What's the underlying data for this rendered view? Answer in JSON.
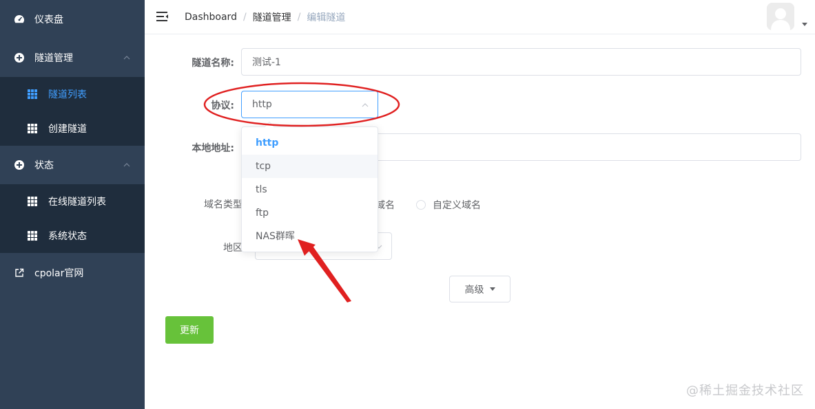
{
  "sidebar": {
    "items": [
      {
        "label": "仪表盘",
        "icon": "dashboard-icon"
      },
      {
        "label": "隧道管理",
        "icon": "circle-plus-icon",
        "expanded": true,
        "children": [
          {
            "label": "隧道列表",
            "icon": "grid-icon",
            "active": true
          },
          {
            "label": "创建隧道",
            "icon": "grid-icon"
          }
        ]
      },
      {
        "label": "状态",
        "icon": "circle-plus-icon",
        "expanded": true,
        "children": [
          {
            "label": "在线隧道列表",
            "icon": "grid-icon"
          },
          {
            "label": "系统状态",
            "icon": "grid-icon"
          }
        ]
      },
      {
        "label": "cpolar官网",
        "icon": "external-link-icon"
      }
    ]
  },
  "header": {
    "breadcrumb": [
      "Dashboard",
      "隧道管理",
      "编辑隧道"
    ],
    "separator": "/"
  },
  "form": {
    "name_label": "隧道名称:",
    "name_value": "测试-1",
    "protocol_label": "协议:",
    "protocol_value": "http",
    "local_address_label": "本地地址:",
    "domain_type_label": "域名类型",
    "domain_option_partial": "域名",
    "domain_option_custom": "自定义域名",
    "region_label": "地区",
    "advanced_label": "高级",
    "update_label": "更新"
  },
  "protocol_dropdown": {
    "options": [
      "http",
      "tcp",
      "tls",
      "ftp",
      "NAS群晖"
    ],
    "selected": "http",
    "hovered": "tcp"
  },
  "colors": {
    "sidebar_bg": "#304156",
    "submenu_bg": "#1f2d3d",
    "accent": "#409eff",
    "update_button": "#67c23a",
    "annotation_red": "#e02020"
  },
  "watermark": "@稀土掘金技术社区"
}
